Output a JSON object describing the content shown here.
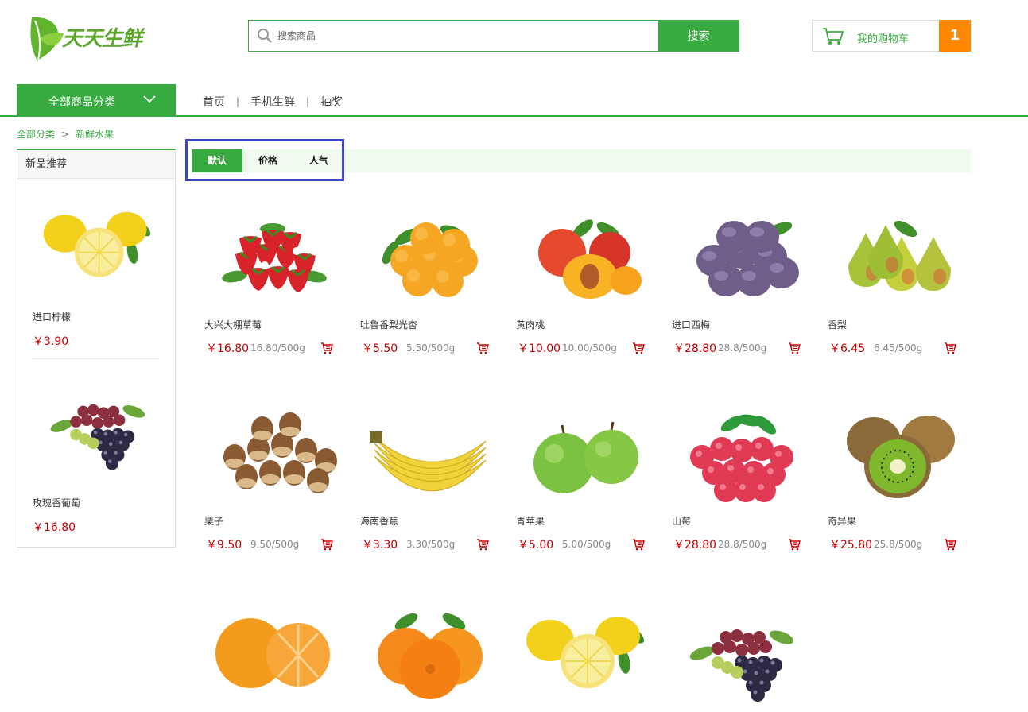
{
  "brand": {
    "name": "天天生鲜"
  },
  "search": {
    "placeholder": "搜索商品",
    "button": "搜索"
  },
  "cart": {
    "label": "我的购物车",
    "count": "1"
  },
  "nav": {
    "category_button": "全部商品分类",
    "links": [
      "首页",
      "手机生鲜",
      "抽奖"
    ]
  },
  "breadcrumb": {
    "root": "全部分类",
    "separator": ">",
    "current": "新鲜水果"
  },
  "sidebar": {
    "title": "新品推荐",
    "items": [
      {
        "name": "进口柠檬",
        "price": "￥3.90",
        "image": "lemon"
      },
      {
        "name": "玫瑰香葡萄",
        "price": "￥16.80",
        "image": "grapes"
      }
    ]
  },
  "sort": {
    "tabs": [
      "默认",
      "价格",
      "人气"
    ],
    "active": "默认"
  },
  "products": [
    {
      "name": "大兴大棚草莓",
      "price": "￥16.80",
      "unit": "16.80/500g",
      "image": "strawberry"
    },
    {
      "name": "吐鲁番梨光杏",
      "price": "￥5.50",
      "unit": "5.50/500g",
      "image": "apricot"
    },
    {
      "name": "黄肉桃",
      "price": "￥10.00",
      "unit": "10.00/500g",
      "image": "peach"
    },
    {
      "name": "进口西梅",
      "price": "￥28.80",
      "unit": "28.8/500g",
      "image": "plum"
    },
    {
      "name": "香梨",
      "price": "￥6.45",
      "unit": "6.45/500g",
      "image": "pear"
    },
    {
      "name": "栗子",
      "price": "￥9.50",
      "unit": "9.50/500g",
      "image": "chestnut"
    },
    {
      "name": "海南香蕉",
      "price": "￥3.30",
      "unit": "3.30/500g",
      "image": "banana"
    },
    {
      "name": "青苹果",
      "price": "￥5.00",
      "unit": "5.00/500g",
      "image": "green-apple"
    },
    {
      "name": "山莓",
      "price": "￥28.80",
      "unit": "28.8/500g",
      "image": "raspberry"
    },
    {
      "name": "奇异果",
      "price": "￥25.80",
      "unit": "25.8/500g",
      "image": "kiwi"
    },
    {
      "name": "",
      "price": "",
      "unit": "",
      "image": "tangerine"
    },
    {
      "name": "",
      "price": "",
      "unit": "",
      "image": "orange"
    },
    {
      "name": "",
      "price": "",
      "unit": "",
      "image": "lemon"
    },
    {
      "name": "",
      "price": "",
      "unit": "",
      "image": "grapes"
    }
  ],
  "colors": {
    "brand_green": "#37ab40",
    "price_red": "#c40000",
    "cart_orange": "#ff8800",
    "highlight_blue": "#3b45c4"
  }
}
